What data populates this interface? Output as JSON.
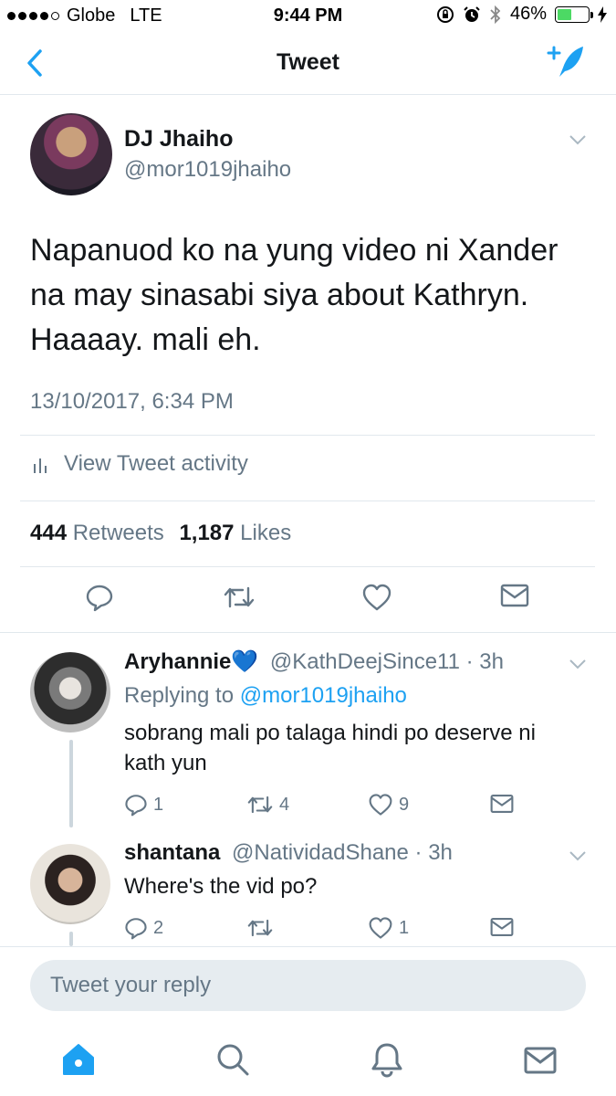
{
  "status_bar": {
    "carrier": "Globe",
    "network": "LTE",
    "time": "9:44 PM",
    "battery": "46%",
    "battery_level": 0.46,
    "battery_color": "#4cd964"
  },
  "nav": {
    "title": "Tweet",
    "back_icon": "chevron-left-icon",
    "compose_icon": "compose-tweet-icon"
  },
  "colors": {
    "accent": "#1da1f2",
    "secondary_text": "#657786",
    "primary_text": "#14171a",
    "divider": "#e1e8ed"
  },
  "tweet": {
    "author_name": "DJ Jhaiho",
    "author_handle": "@mor1019jhaiho",
    "text": "Napanuod ko na yung video ni Xander na may sinasabi siya about Kathryn. Haaaay. mali eh.",
    "timestamp": "13/10/2017, 6:34 PM",
    "activity_label": "View Tweet activity",
    "retweets_count": "444",
    "retweets_label": "Retweets",
    "likes_count": "1,187",
    "likes_label": "Likes"
  },
  "replies": [
    {
      "name": "Aryhannie💙",
      "handle": "@KathDeejSince11",
      "time": "· 3h",
      "replying_prefix": "Replying to",
      "replying_to": "@mor1019jhaiho",
      "text": "sobrang mali po talaga hindi po deserve ni kath yun",
      "reply_count": "1",
      "retweet_count": "4",
      "like_count": "9"
    },
    {
      "name": "shantana",
      "handle": "@NatividadShane",
      "time": "· 3h",
      "text": "Where's the vid po?",
      "reply_count": "2",
      "retweet_count": "",
      "like_count": "1"
    }
  ],
  "composer": {
    "placeholder": "Tweet your reply"
  },
  "tab_bar": {
    "items": [
      "home-icon",
      "search-icon",
      "notifications-icon",
      "messages-icon"
    ],
    "active": "home-icon"
  }
}
